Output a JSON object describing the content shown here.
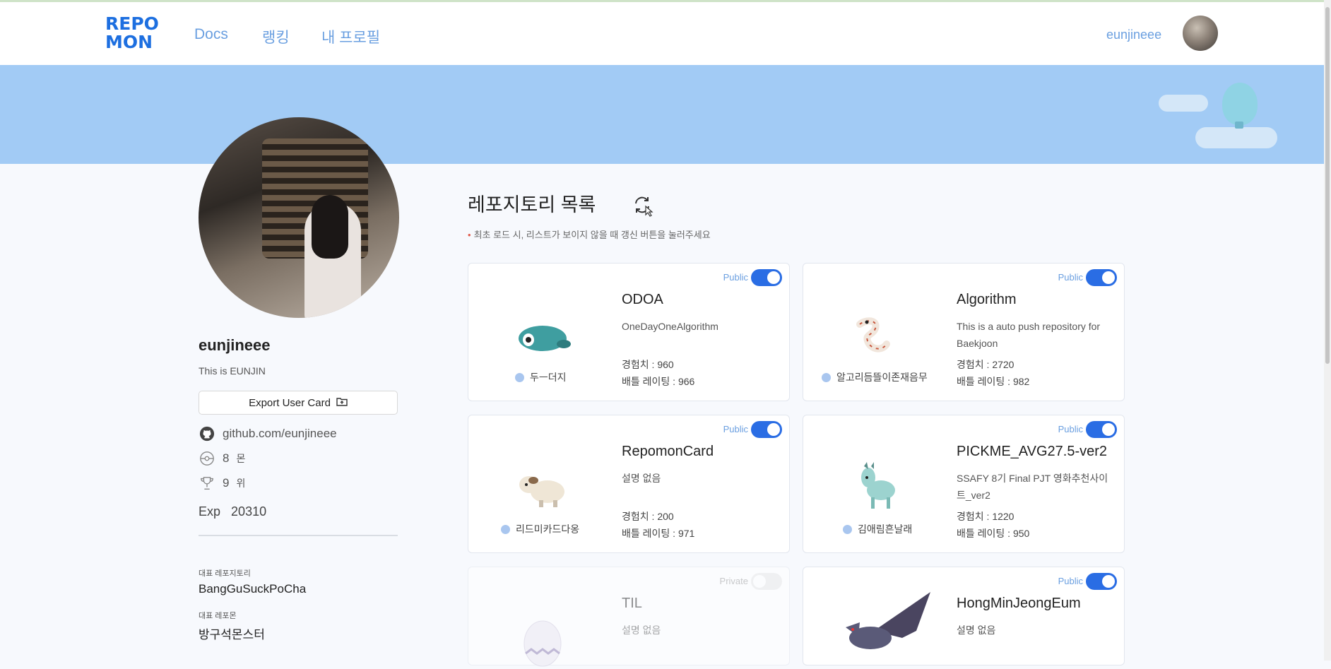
{
  "nav": {
    "logo_line1": "REPO",
    "logo_line2": "MON",
    "links": [
      "Docs",
      "랭킹",
      "내 프로필"
    ],
    "username": "eunjineee"
  },
  "profile": {
    "username": "eunjineee",
    "bio": "This is EUNJIN",
    "export_label": "Export User Card",
    "github": "github.com/eunjineee",
    "monster_count": "8",
    "monster_unit": "몬",
    "rank": "9",
    "rank_unit": "위",
    "exp_label": "Exp",
    "exp_value": "20310",
    "rep_repo_label": "대표 레포지토리",
    "rep_repo_value": "BangGuSuckPoCha",
    "rep_mon_label": "대표 레포몬",
    "rep_mon_value": "방구석몬스터"
  },
  "repos": {
    "title": "레포지토리 목록",
    "notice": "최초 로드 시, 리스트가 보이지 않을 때 갱신 버튼을 눌러주세요",
    "exp_label": "경험치 : ",
    "rating_label": "배틀 레이팅 : ",
    "cards": [
      {
        "name": "ODOA",
        "desc": "OneDayOneAlgorithm",
        "visibility": "Public",
        "exp": "960",
        "rating": "966",
        "monster": "두ㅡ더지"
      },
      {
        "name": "Algorithm",
        "desc": "This is a auto push repository for Baekjoon",
        "visibility": "Public",
        "exp": "2720",
        "rating": "982",
        "monster": "알고리듬뜰이존재음무"
      },
      {
        "name": "RepomonCard",
        "desc": "설명 없음",
        "visibility": "Public",
        "exp": "200",
        "rating": "971",
        "monster": "리드미카드다옹"
      },
      {
        "name": "PICKME_AVG27.5-ver2",
        "desc": "SSAFY 8기 Final PJT 영화추천사이트_ver2",
        "visibility": "Public",
        "exp": "1220",
        "rating": "950",
        "monster": "김애림흔날래"
      },
      {
        "name": "TIL",
        "desc": "설명 없음",
        "visibility": "Private"
      },
      {
        "name": "HongMinJeongEum",
        "desc": "설명 없음",
        "visibility": "Public"
      }
    ]
  },
  "colors": {
    "accent": "#2a6de4",
    "link": "#6a9fe0",
    "banner": "#a2cbf5"
  }
}
